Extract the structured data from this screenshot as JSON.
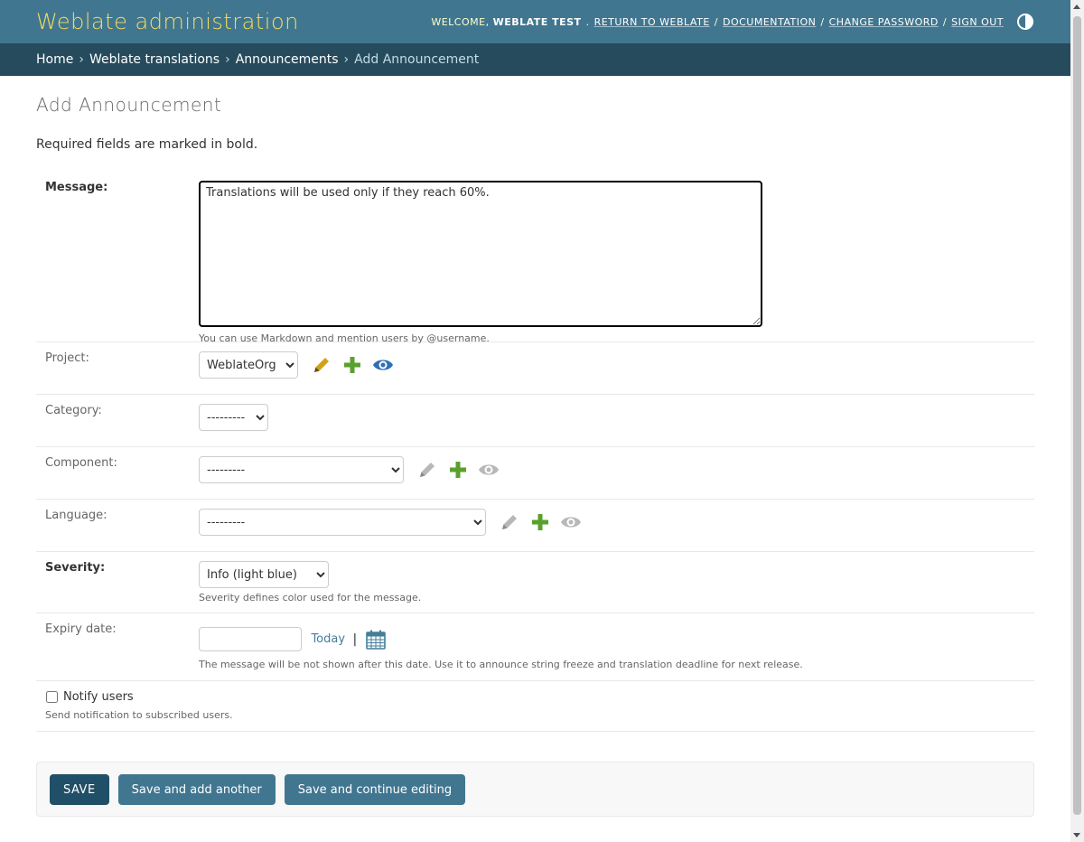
{
  "header": {
    "branding": "Weblate administration",
    "welcome_label": "Welcome,",
    "user_name": "Weblate Test",
    "links": [
      "Return to Weblate",
      "Documentation",
      "Change password",
      "Sign out"
    ]
  },
  "breadcrumbs": [
    "Home",
    "Weblate translations",
    "Announcements",
    "Add Announcement"
  ],
  "page": {
    "title": "Add Announcement",
    "required_note": "Required fields are marked in bold."
  },
  "form": {
    "message": {
      "label": "Message:",
      "value": "Translations will be used only if they reach 60%.",
      "help": "You can use Markdown and mention users by @username."
    },
    "project": {
      "label": "Project:",
      "selected": "WeblateOrg"
    },
    "category": {
      "label": "Category:",
      "selected": "---------"
    },
    "component": {
      "label": "Component:",
      "selected": "---------"
    },
    "language": {
      "label": "Language:",
      "selected": "---------"
    },
    "severity": {
      "label": "Severity:",
      "selected": "Info (light blue)",
      "help": "Severity defines color used for the message."
    },
    "expiry": {
      "label": "Expiry date:",
      "value": "",
      "today_label": "Today",
      "separator": "|",
      "help": "The message will be not shown after this date. Use it to announce string freeze and translation deadline for next release."
    },
    "notify": {
      "label": "Notify users",
      "checked": false,
      "help": "Send notification to subscribed users."
    }
  },
  "buttons": {
    "save": "Save",
    "save_add": "Save and add another",
    "save_continue": "Save and continue editing"
  },
  "icons": {
    "change": "pencil-icon",
    "add": "plus-icon",
    "view": "eye-icon",
    "calendar": "calendar-icon",
    "theme": "theme-toggle-icon"
  },
  "colors": {
    "header_bg": "#417690",
    "breadcrumb_bg": "#264b5d",
    "branding": "#f5dd5d",
    "primary_button": "#205067",
    "secondary_button": "#417690"
  }
}
